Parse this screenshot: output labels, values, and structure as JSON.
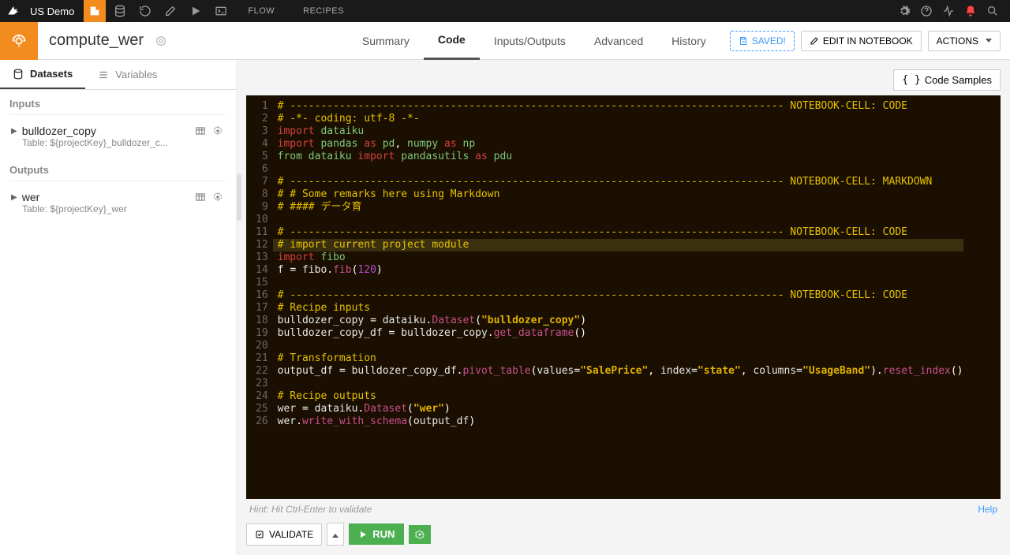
{
  "topbar": {
    "project": "US Demo",
    "nav": {
      "flow": "FLOW",
      "recipes": "RECIPES"
    }
  },
  "header": {
    "title": "compute_wer",
    "tabs": {
      "summary": "Summary",
      "code": "Code",
      "io": "Inputs/Outputs",
      "advanced": "Advanced",
      "history": "History"
    },
    "saved": "SAVED!",
    "edit_notebook": "EDIT IN NOTEBOOK",
    "actions": "ACTIONS"
  },
  "sidebar": {
    "tab_datasets": "Datasets",
    "tab_variables": "Variables",
    "inputs_label": "Inputs",
    "outputs_label": "Outputs",
    "inputs": [
      {
        "name": "bulldozer_copy",
        "sub": "Table: ${projectKey}_bulldozer_c..."
      }
    ],
    "outputs": [
      {
        "name": "wer",
        "sub": "Table: ${projectKey}_wer"
      }
    ]
  },
  "editor": {
    "code_samples": "Code Samples",
    "hint": "Hint: Hit Ctrl-Enter to validate",
    "help": "Help"
  },
  "footer": {
    "validate": "VALIDATE",
    "run": "RUN"
  },
  "code": {
    "lines": [
      {
        "n": 1,
        "tokens": [
          [
            "comment",
            "# -------------------------------------------------------------------------------- NOTEBOOK-CELL: CODE"
          ]
        ]
      },
      {
        "n": 2,
        "tokens": [
          [
            "comment",
            "# -*- coding: utf-8 -*-"
          ]
        ]
      },
      {
        "n": 3,
        "tokens": [
          [
            "key",
            "import"
          ],
          [
            "sp",
            " "
          ],
          [
            "name",
            "dataiku"
          ]
        ]
      },
      {
        "n": 4,
        "tokens": [
          [
            "key",
            "import"
          ],
          [
            "sp",
            " "
          ],
          [
            "name",
            "pandas"
          ],
          [
            "sp",
            " "
          ],
          [
            "as",
            "as"
          ],
          [
            "sp",
            " "
          ],
          [
            "name",
            "pd"
          ],
          [
            "punct",
            ", "
          ],
          [
            "name",
            "numpy"
          ],
          [
            "sp",
            " "
          ],
          [
            "as",
            "as"
          ],
          [
            "sp",
            " "
          ],
          [
            "name",
            "np"
          ]
        ]
      },
      {
        "n": 5,
        "tokens": [
          [
            "from",
            "from"
          ],
          [
            "sp",
            " "
          ],
          [
            "name",
            "dataiku"
          ],
          [
            "sp",
            " "
          ],
          [
            "key",
            "import"
          ],
          [
            "sp",
            " "
          ],
          [
            "name",
            "pandasutils"
          ],
          [
            "sp",
            " "
          ],
          [
            "as",
            "as"
          ],
          [
            "sp",
            " "
          ],
          [
            "name",
            "pdu"
          ]
        ]
      },
      {
        "n": 6,
        "tokens": []
      },
      {
        "n": 7,
        "tokens": [
          [
            "comment",
            "# -------------------------------------------------------------------------------- NOTEBOOK-CELL: MARKDOWN"
          ]
        ]
      },
      {
        "n": 8,
        "tokens": [
          [
            "comment",
            "# # Some remarks here using Markdown"
          ]
        ]
      },
      {
        "n": 9,
        "tokens": [
          [
            "comment",
            "# #### データ育"
          ]
        ]
      },
      {
        "n": 10,
        "tokens": []
      },
      {
        "n": 11,
        "tokens": [
          [
            "comment",
            "# -------------------------------------------------------------------------------- NOTEBOOK-CELL: CODE"
          ]
        ]
      },
      {
        "n": 12,
        "hl": true,
        "tokens": [
          [
            "comment",
            "# import current project module"
          ]
        ]
      },
      {
        "n": 13,
        "tokens": [
          [
            "key",
            "import"
          ],
          [
            "sp",
            " "
          ],
          [
            "name",
            "fibo"
          ]
        ]
      },
      {
        "n": 14,
        "tokens": [
          [
            "id",
            "f "
          ],
          [
            "punct",
            "= "
          ],
          [
            "id",
            "fibo"
          ],
          [
            "punct",
            "."
          ],
          [
            "call",
            "fib"
          ],
          [
            "punct",
            "("
          ],
          [
            "num",
            "120"
          ],
          [
            "punct",
            ")"
          ]
        ]
      },
      {
        "n": 15,
        "tokens": []
      },
      {
        "n": 16,
        "tokens": [
          [
            "comment",
            "# -------------------------------------------------------------------------------- NOTEBOOK-CELL: CODE"
          ]
        ]
      },
      {
        "n": 17,
        "tokens": [
          [
            "comment",
            "# Recipe inputs"
          ]
        ]
      },
      {
        "n": 18,
        "tokens": [
          [
            "id",
            "bulldozer_copy "
          ],
          [
            "punct",
            "= "
          ],
          [
            "id",
            "dataiku"
          ],
          [
            "punct",
            "."
          ],
          [
            "call",
            "Dataset"
          ],
          [
            "punct",
            "("
          ],
          [
            "str",
            "\"bulldozer_copy\""
          ],
          [
            "punct",
            ")"
          ]
        ]
      },
      {
        "n": 19,
        "tokens": [
          [
            "id",
            "bulldozer_copy_df "
          ],
          [
            "punct",
            "= "
          ],
          [
            "id",
            "bulldozer_copy"
          ],
          [
            "punct",
            "."
          ],
          [
            "call",
            "get_dataframe"
          ],
          [
            "punct",
            "()"
          ]
        ]
      },
      {
        "n": 20,
        "tokens": []
      },
      {
        "n": 21,
        "tokens": [
          [
            "comment",
            "# Transformation"
          ]
        ]
      },
      {
        "n": 22,
        "tokens": [
          [
            "id",
            "output_df "
          ],
          [
            "punct",
            "= "
          ],
          [
            "id",
            "bulldozer_copy_df"
          ],
          [
            "punct",
            "."
          ],
          [
            "call",
            "pivot_table"
          ],
          [
            "punct",
            "("
          ],
          [
            "id",
            "values"
          ],
          [
            "punct",
            "="
          ],
          [
            "str",
            "\"SalePrice\""
          ],
          [
            "punct",
            ", "
          ],
          [
            "id",
            "index"
          ],
          [
            "punct",
            "="
          ],
          [
            "str",
            "\"state\""
          ],
          [
            "punct",
            ", "
          ],
          [
            "id",
            "columns"
          ],
          [
            "punct",
            "="
          ],
          [
            "str",
            "\"UsageBand\""
          ],
          [
            "punct",
            ")."
          ],
          [
            "call",
            "reset_index"
          ],
          [
            "punct",
            "()"
          ]
        ]
      },
      {
        "n": 23,
        "tokens": []
      },
      {
        "n": 24,
        "tokens": [
          [
            "comment",
            "# Recipe outputs"
          ]
        ]
      },
      {
        "n": 25,
        "tokens": [
          [
            "id",
            "wer "
          ],
          [
            "punct",
            "= "
          ],
          [
            "id",
            "dataiku"
          ],
          [
            "punct",
            "."
          ],
          [
            "call",
            "Dataset"
          ],
          [
            "punct",
            "("
          ],
          [
            "str",
            "\"wer\""
          ],
          [
            "punct",
            ")"
          ]
        ]
      },
      {
        "n": 26,
        "tokens": [
          [
            "id",
            "wer"
          ],
          [
            "punct",
            "."
          ],
          [
            "call",
            "write_with_schema"
          ],
          [
            "punct",
            "("
          ],
          [
            "id",
            "output_df"
          ],
          [
            "punct",
            ")"
          ]
        ]
      }
    ]
  }
}
